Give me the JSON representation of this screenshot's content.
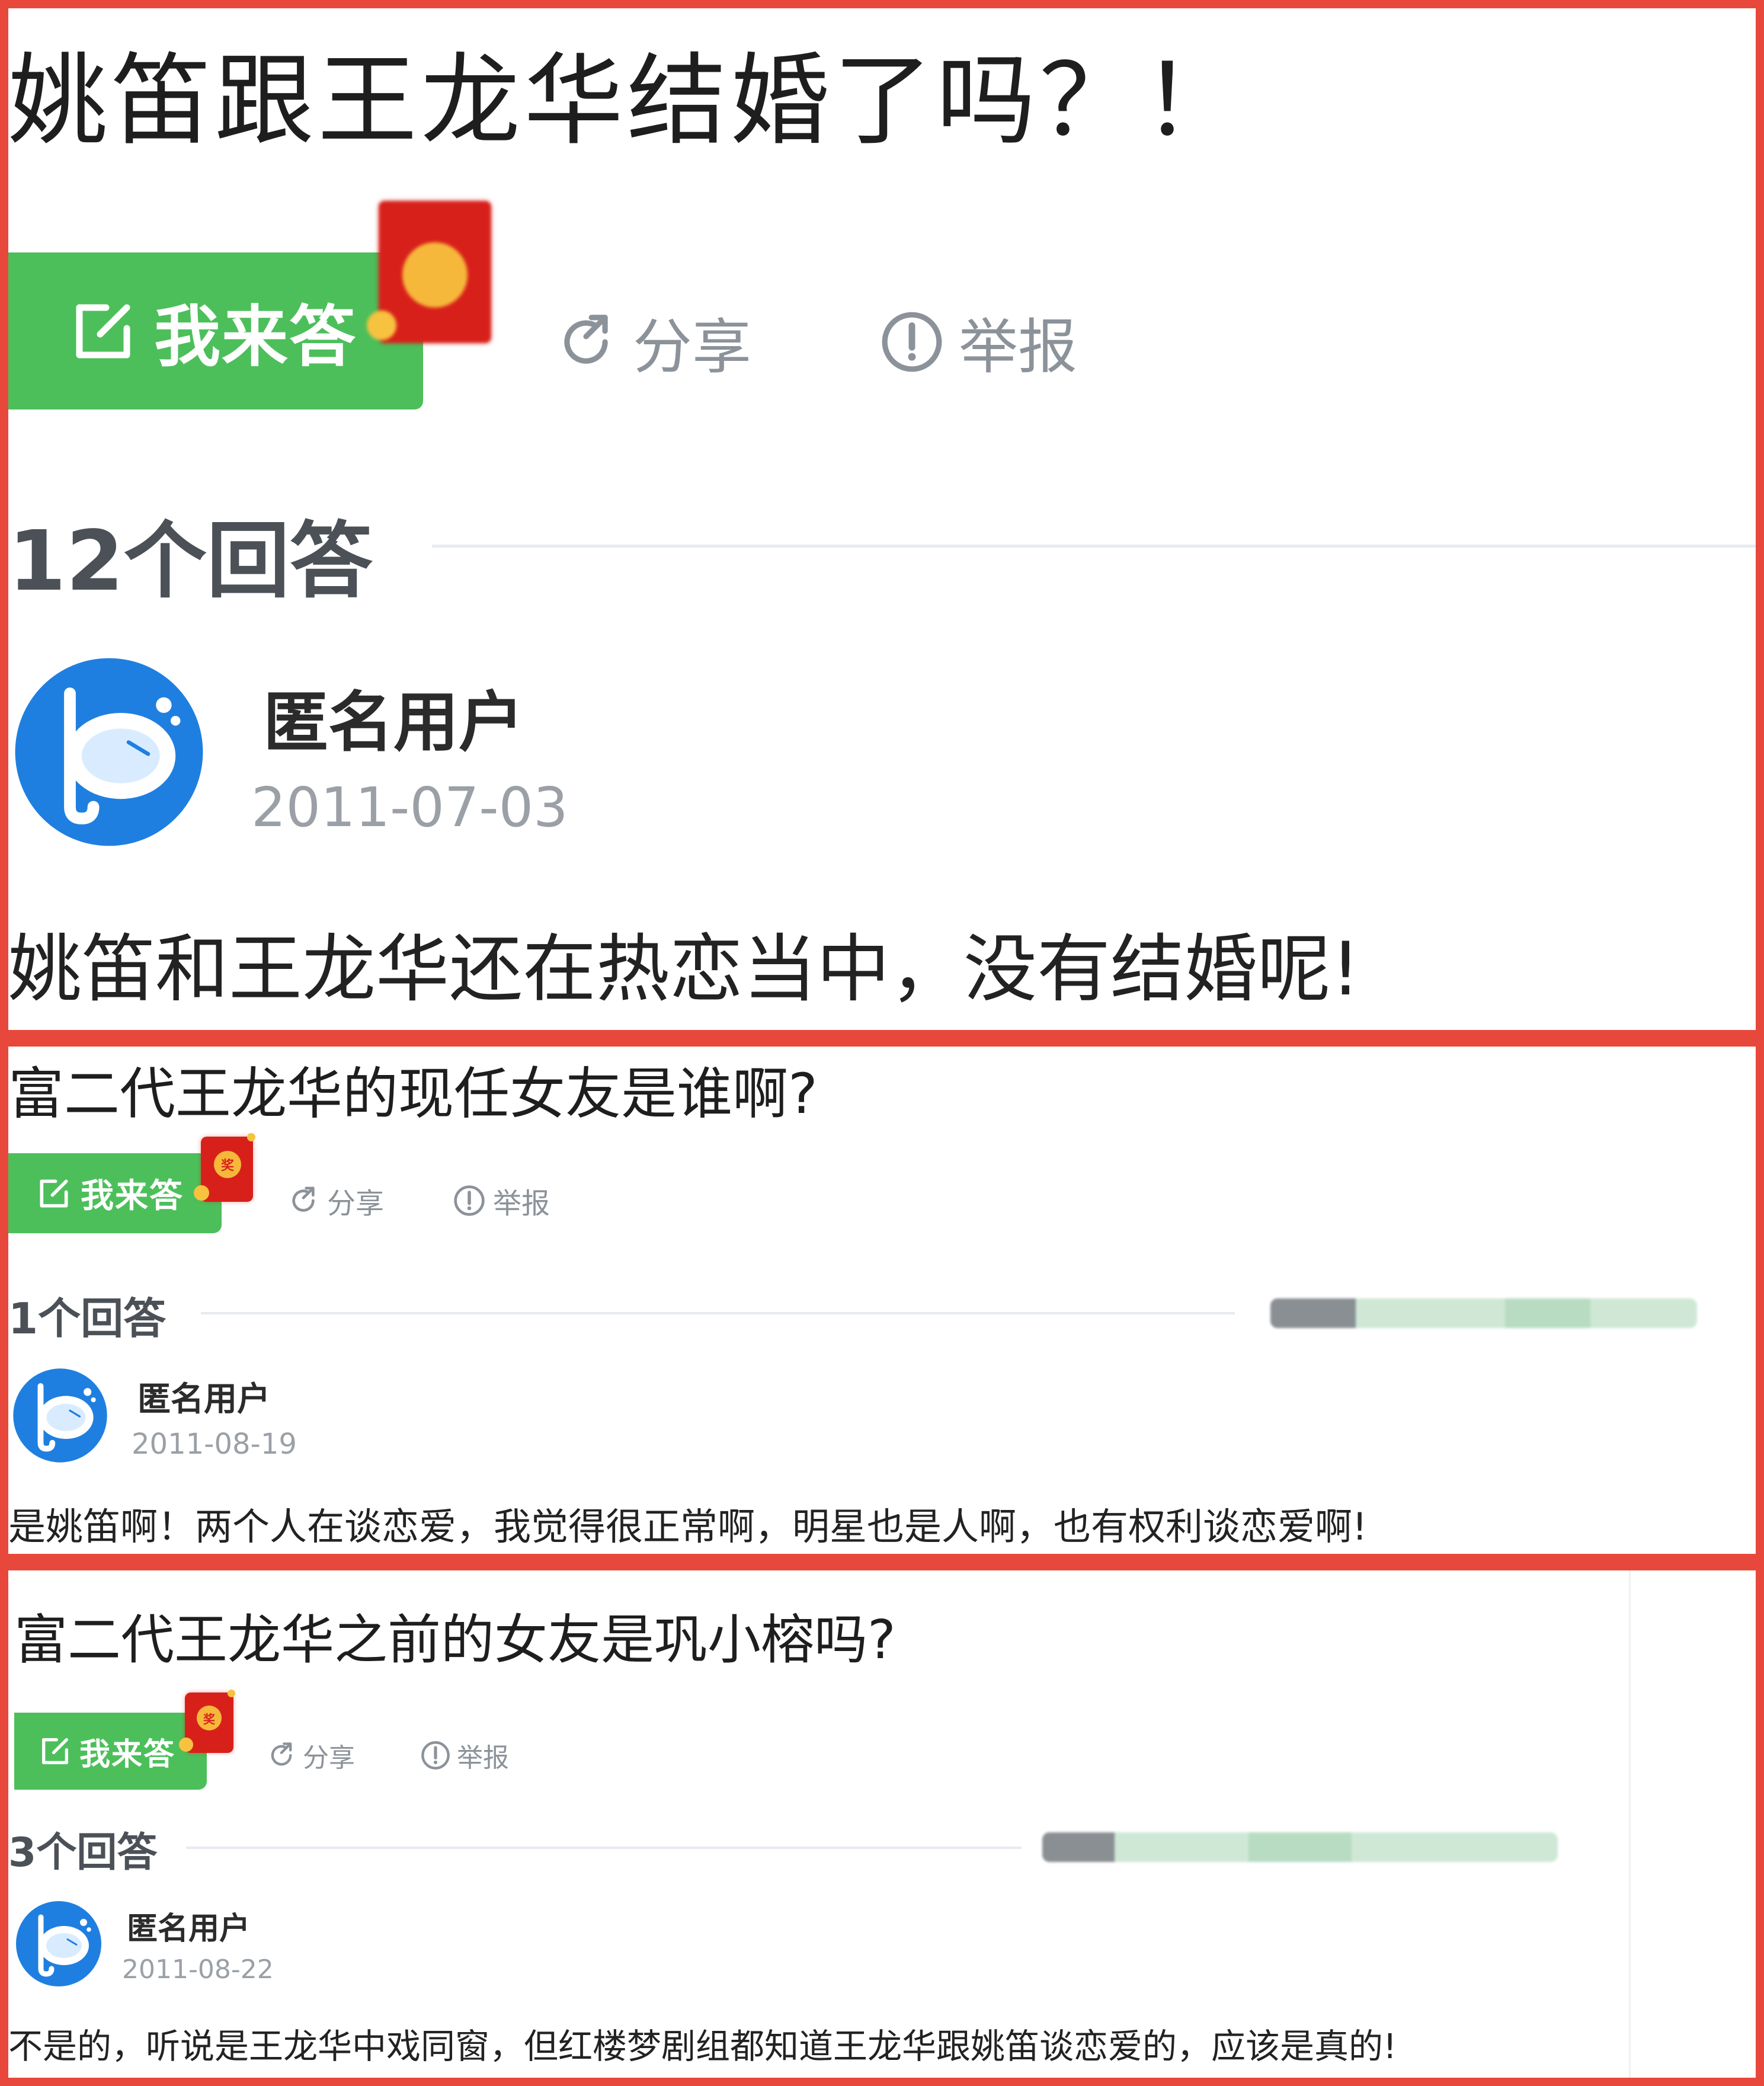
{
  "colors": {
    "panel_border": "#e8483c",
    "answer_button": "#4cbf5b",
    "red_packet": "#d8201b",
    "muted_text": "#8c9299",
    "avatar_blue": "#1f7fe0"
  },
  "questions": [
    {
      "title": "姚笛跟王龙华结婚了吗？！",
      "answer_label": "我来答",
      "share_label": "分享",
      "report_label": "举报",
      "answer_count": "12个回答",
      "user": "匿名用户",
      "date": "2011-07-03",
      "answer_text": "姚笛和王龙华还在热恋当中，没有结婚呢!"
    },
    {
      "title": "富二代王龙华的现任女友是谁啊?",
      "answer_label": "我来答",
      "share_label": "分享",
      "report_label": "举报",
      "answer_count": "1个回答",
      "user": "匿名用户",
      "date": "2011-08-19",
      "answer_text": "是姚笛啊！两个人在谈恋爱，我觉得很正常啊，明星也是人啊，也有权利谈恋爱啊!"
    },
    {
      "title": "富二代王龙华之前的女友是巩小榕吗?",
      "answer_label": "我来答",
      "share_label": "分享",
      "report_label": "举报",
      "answer_count": "3个回答",
      "user": "匿名用户",
      "date": "2011-08-22",
      "answer_text": "不是的，听说是王龙华中戏同窗，但红楼梦剧组都知道王龙华跟姚笛谈恋爱的，应该是真的!"
    }
  ]
}
